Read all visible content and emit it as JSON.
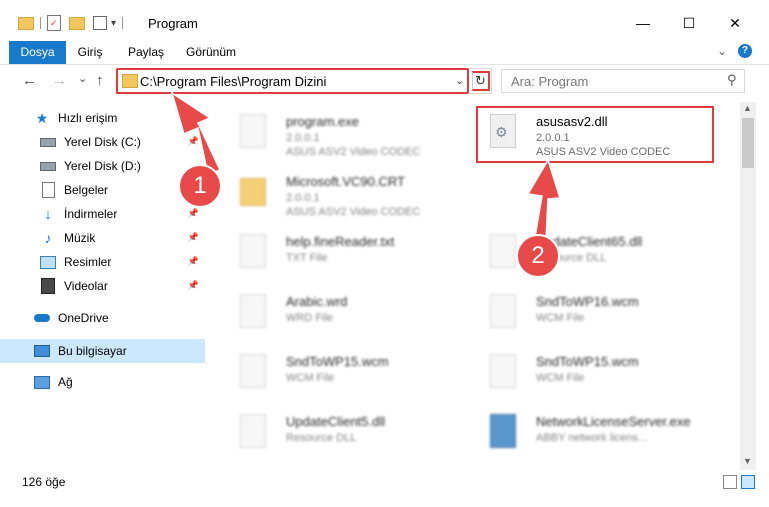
{
  "window": {
    "title": "Program",
    "minimize": "—",
    "maximize": "☐",
    "close": "✕"
  },
  "ribbon": {
    "tabs": [
      "Dosya",
      "Giriş",
      "Paylaş",
      "Görünüm"
    ],
    "expand": "⌄",
    "help": "?"
  },
  "nav": {
    "back": "←",
    "forward": "→",
    "recent": "⌄",
    "up": "↑",
    "address": "C:\\Program Files\\Program Dizini",
    "refresh": "↻",
    "search_placeholder": "Ara: Program",
    "search_icon": "⚲"
  },
  "sidebar": {
    "items": [
      {
        "label": "Hızlı erişim",
        "icon": "star-icon"
      },
      {
        "label": "Yerel Disk (C:)",
        "icon": "drive-icon"
      },
      {
        "label": "Yerel Disk (D:)",
        "icon": "drive-icon"
      },
      {
        "label": "Belgeler",
        "icon": "document-icon"
      },
      {
        "label": "İndirmeler",
        "icon": "download-icon"
      },
      {
        "label": "Müzik",
        "icon": "music-icon"
      },
      {
        "label": "Resimler",
        "icon": "pictures-icon"
      },
      {
        "label": "Videolar",
        "icon": "video-icon"
      },
      {
        "label": "OneDrive",
        "icon": "cloud-icon"
      },
      {
        "label": "Bu bilgisayar",
        "icon": "computer-icon"
      },
      {
        "label": "Ağ",
        "icon": "network-icon"
      }
    ]
  },
  "files": [
    {
      "name": "program.exe",
      "line1": "2.0.0.1",
      "line2": "ASUS ASV2 Video CODEC"
    },
    {
      "name": "asusasv2.dll",
      "line1": "2.0.0.1",
      "line2": "ASUS ASV2 Video CODEC"
    },
    {
      "name": "Microsoft.VC90.CRT",
      "line1": "2.0.0.1",
      "line2": "ASUS ASV2 Video CODEC"
    },
    {
      "name": "help.fineReader.txt",
      "line1": "TXT File",
      "line2": ""
    },
    {
      "name": "UpdateClient65.dll",
      "line1": "Resource DLL",
      "line2": ""
    },
    {
      "name": "Arabic.wrd",
      "line1": "WRD File",
      "line2": ""
    },
    {
      "name": "SndToWP16.wcm",
      "line1": "WCM File",
      "line2": ""
    },
    {
      "name": "SndToWP15.wcm",
      "line1": "WCM File",
      "line2": ""
    },
    {
      "name": "SndToWP15.wcm",
      "line1": "WCM File",
      "line2": ""
    },
    {
      "name": "UpdateClient5.dll",
      "line1": "Resource DLL",
      "line2": ""
    },
    {
      "name": "NetworkLicenseServer.exe",
      "line1": "ABBY network licens...",
      "line2": ""
    }
  ],
  "status": {
    "count": "126 öğe"
  },
  "annotations": {
    "step1": "1",
    "step2": "2"
  },
  "colors": {
    "accent": "#1979ca",
    "highlight": "#e03b3b",
    "selection": "#cce8ff"
  }
}
